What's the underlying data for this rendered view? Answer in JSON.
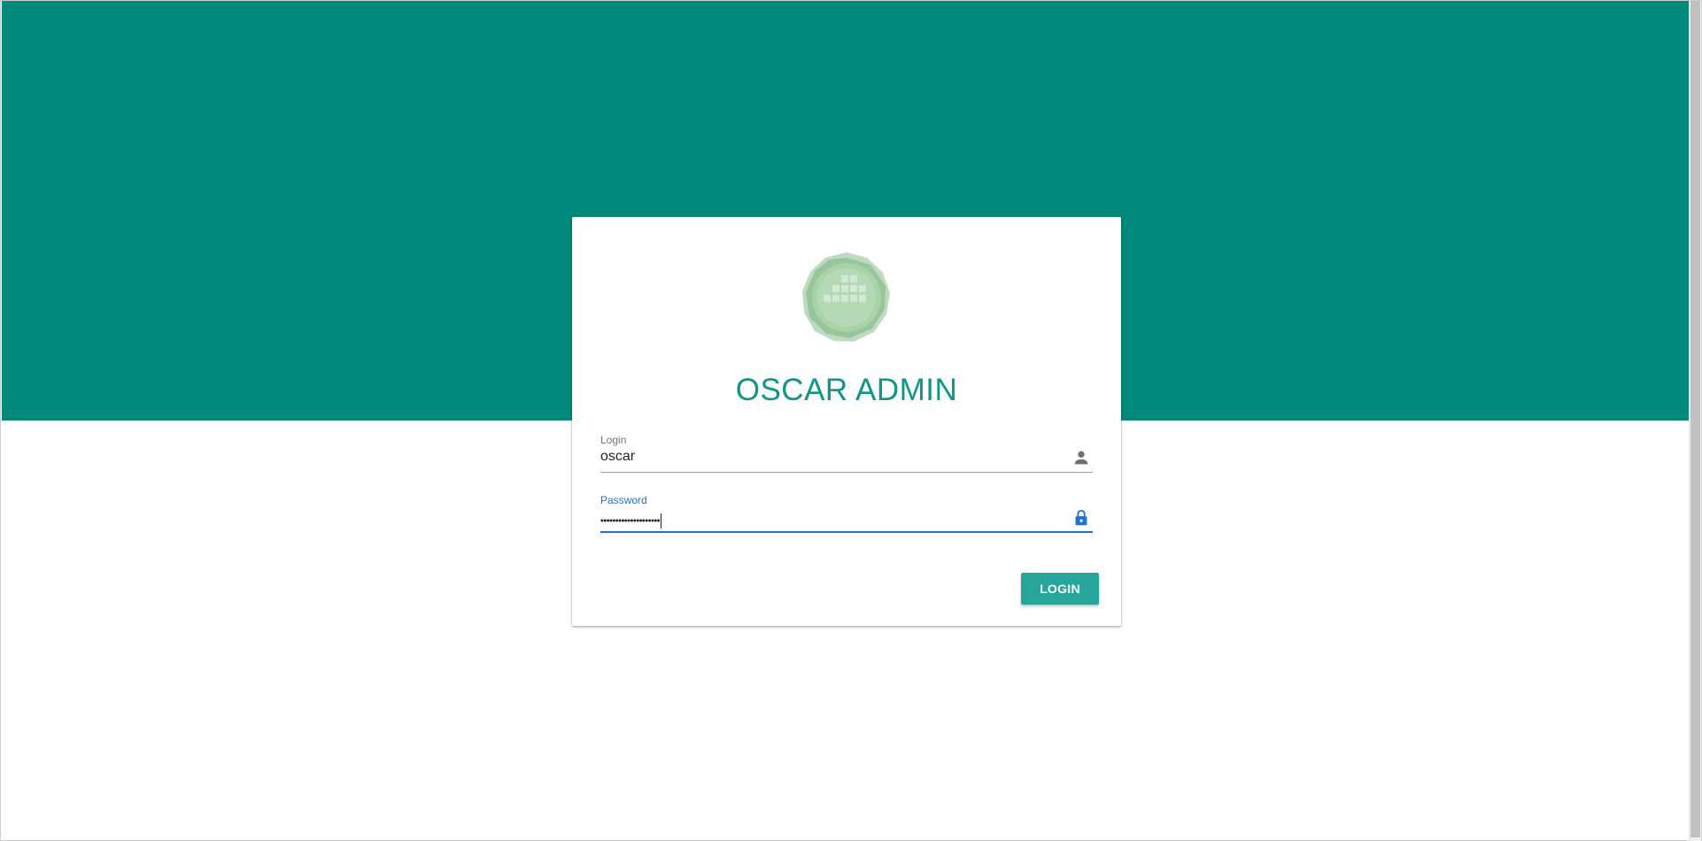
{
  "app": {
    "title": "OSCAR ADMIN",
    "accent_color": "#01897b",
    "title_color": "#0e9688",
    "logo_icon": "oscar-logo-icon"
  },
  "form": {
    "login": {
      "label": "Login",
      "value": "oscar",
      "icon": "person-icon"
    },
    "password": {
      "label": "Password",
      "value": "••••••••••••••••••••",
      "icon": "lock-icon",
      "focused": true
    },
    "submit_label": "LOGIN"
  }
}
